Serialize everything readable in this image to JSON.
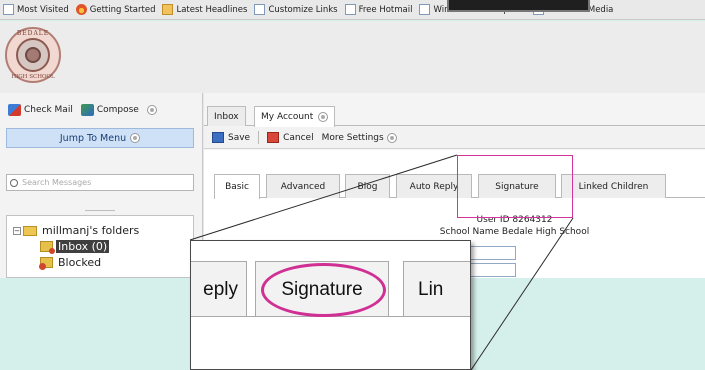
{
  "bookmarks": [
    {
      "label": "Most Visited",
      "icon": "page-icon"
    },
    {
      "label": "Getting Started",
      "icon": "firefox-icon"
    },
    {
      "label": "Latest Headlines",
      "icon": "rss-icon"
    },
    {
      "label": "Customize Links",
      "icon": "page-icon"
    },
    {
      "label": "Free Hotmail",
      "icon": "page-icon"
    },
    {
      "label": "Windows Marketplace",
      "icon": "page-icon"
    },
    {
      "label": "Windows Media",
      "icon": "page-icon"
    }
  ],
  "logo": {
    "top_text": "BEDALE",
    "bottom_text": "HIGH SCHOOL"
  },
  "sidebar": {
    "check_mail": "Check Mail",
    "compose": "Compose",
    "jump_menu": "Jump To Menu",
    "search_placeholder": "Search Messages",
    "folders_title": "millmanj's folders",
    "inbox": "Inbox (0)",
    "blocked": "Blocked"
  },
  "main": {
    "tabs": [
      {
        "label": "Inbox"
      },
      {
        "label": "My Account"
      }
    ],
    "toolbar": {
      "save": "Save",
      "cancel": "Cancel",
      "more": "More Settings"
    },
    "inner_tabs": [
      "Basic",
      "Advanced",
      "Blog",
      "Auto Reply",
      "Signature",
      "Linked Children"
    ],
    "user_id": "User ID 8264312",
    "school_name": "School Name Bedale High School"
  },
  "zoom": {
    "left_label": "eply",
    "center_label": "Signature",
    "right_label": "Lin"
  },
  "colors": {
    "highlight": "#d3359b",
    "jump_menu_bg": "#cfe1f7",
    "background": "#d5efeb"
  }
}
